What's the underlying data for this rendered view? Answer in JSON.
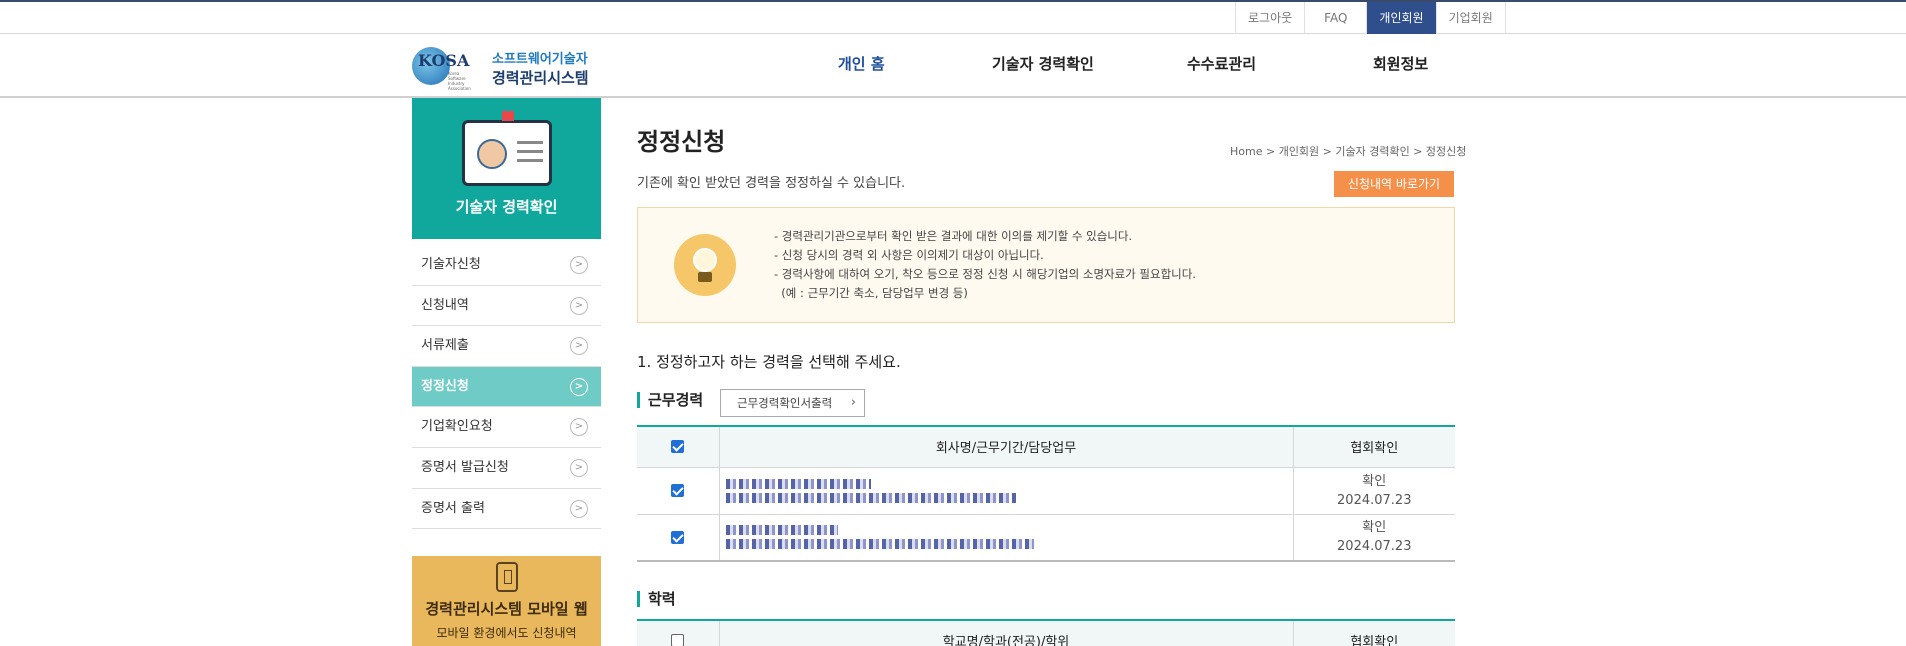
{
  "util": {
    "logout": "로그아웃",
    "faq": "FAQ",
    "personal": "개인회원",
    "corporate": "기업회원"
  },
  "logo": {
    "kosa": "KOSA",
    "sub": "Korea Software Industry Association",
    "line1": "소프트웨어기술자",
    "line2": "경력관리시스템"
  },
  "gnb": {
    "home": "개인 홈",
    "career": "기술자 경력확인",
    "fee": "수수료관리",
    "member": "회원정보"
  },
  "sidebar": {
    "banner_title": "기술자 경력확인",
    "items": [
      {
        "label": "기술자신청"
      },
      {
        "label": "신청내역"
      },
      {
        "label": "서류제출"
      },
      {
        "label": "정정신청"
      },
      {
        "label": "기업확인요청"
      },
      {
        "label": "증명서 발급신청"
      },
      {
        "label": "증명서 출력"
      }
    ],
    "mobile_title": "경력관리시스템 모바일 웹",
    "mobile_desc": "모바일 환경에서도 신청내역"
  },
  "main": {
    "title": "정정신청",
    "breadcrumb": "Home > 개인회원 > 기술자 경력확인 > 정정신청",
    "desc": "기존에 확인 받았던 경력을 정정하실 수 있습니다.",
    "history_button": "신청내역 바로가기",
    "notice": [
      "- 경력관리기관으로부터 확인 받은 결과에 대한 이의를 제기할 수 있습니다.",
      "- 신청 당시의 경력 외 사항은 이의제기 대상이 아닙니다.",
      "- 경력사항에 대하여 오기, 착오 등으로 정정 신청 시 해당기업의 소명자료가 필요합니다.",
      "  (예 : 근무기간 축소, 담당업무 변경 등)"
    ],
    "question": "1. 정정하고자 하는 경력을 선택해 주세요.",
    "work": {
      "heading": "근무경력",
      "print_button": "근무경력확인서출력",
      "col_company": "회사명/근무기간/담당업무",
      "col_confirm": "협회확인",
      "rows": [
        {
          "status": "확인",
          "date": "2024.07.23",
          "checked": true
        },
        {
          "status": "확인",
          "date": "2024.07.23",
          "checked": true
        }
      ]
    },
    "education": {
      "heading": "학력",
      "col_school": "학교명/학과(전공)/학위",
      "col_confirm": "협회확인"
    }
  }
}
